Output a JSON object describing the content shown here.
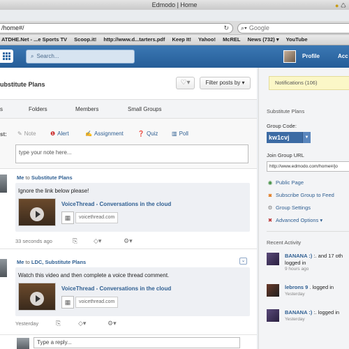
{
  "browser": {
    "window_title": "Edmodo | Home",
    "url": "/home#/",
    "search_placeholder": "Google",
    "bookmarks": [
      "ATDHE.Net - ...e Sports TV",
      "Scoop.it!",
      "http://www.d...tarters.pdf",
      "Keep It!",
      "Yahoo!",
      "McREL",
      "News (732) ▾",
      "YouTube"
    ]
  },
  "appbar": {
    "search_placeholder": "Search...",
    "profile_label": "Profile",
    "account_label": "Acc"
  },
  "main": {
    "group_title": "ubstitute Plans",
    "filter_label": "Filter posts by ▾",
    "tabs": [
      "s",
      "Folders",
      "Members",
      "Small Groups"
    ],
    "composer": {
      "label": "st:",
      "types": [
        "Note",
        "Alert",
        "Assignment",
        "Quiz",
        "Poll"
      ],
      "placeholder": "type your note here..."
    },
    "posts": [
      {
        "sender": "Me",
        "to_word": "to",
        "recipients": "Substitute Plans",
        "text": "Ignore the link below please!",
        "attachment_title": "VoiceThread - Conversations in the cloud",
        "attachment_url": "voicethread.com",
        "time": "33 seconds ago"
      },
      {
        "sender": "Me",
        "to_word": "to",
        "recipients": "LDC, Substitute Plans",
        "text": "Watch this video and then complete a voice thread comment.",
        "attachment_title": "VoiceThread - Conversations in the cloud",
        "attachment_url": "voicethread.com",
        "time": "Yesterday"
      }
    ],
    "reply_placeholder": "Type a reply..."
  },
  "sidebar": {
    "notifications": "Notifications (106)",
    "group_name": "Substitute Plans",
    "group_code_label": "Group Code:",
    "group_code": "kw1cvj",
    "join_url_label": "Join Group URL",
    "join_url": "http://www.edmodo.com/home#/jo",
    "links": [
      "Public Page",
      "Subscribe Group to Feed",
      "Group Settings",
      "Advanced Options ▾"
    ],
    "recent_activity_title": "Recent Activity",
    "activity": [
      {
        "name": "BANANA :)",
        "action_1": ":. and 17 oth",
        "action_2": "logged in",
        "time": "9 hours ago"
      },
      {
        "name": "lebrons 9",
        "action_1": ". logged in",
        "action_2": "",
        "time": "Yesterday"
      },
      {
        "name": "BANANA :)",
        "action_1": ":. logged in",
        "action_2": "",
        "time": "Yesterday"
      }
    ]
  }
}
